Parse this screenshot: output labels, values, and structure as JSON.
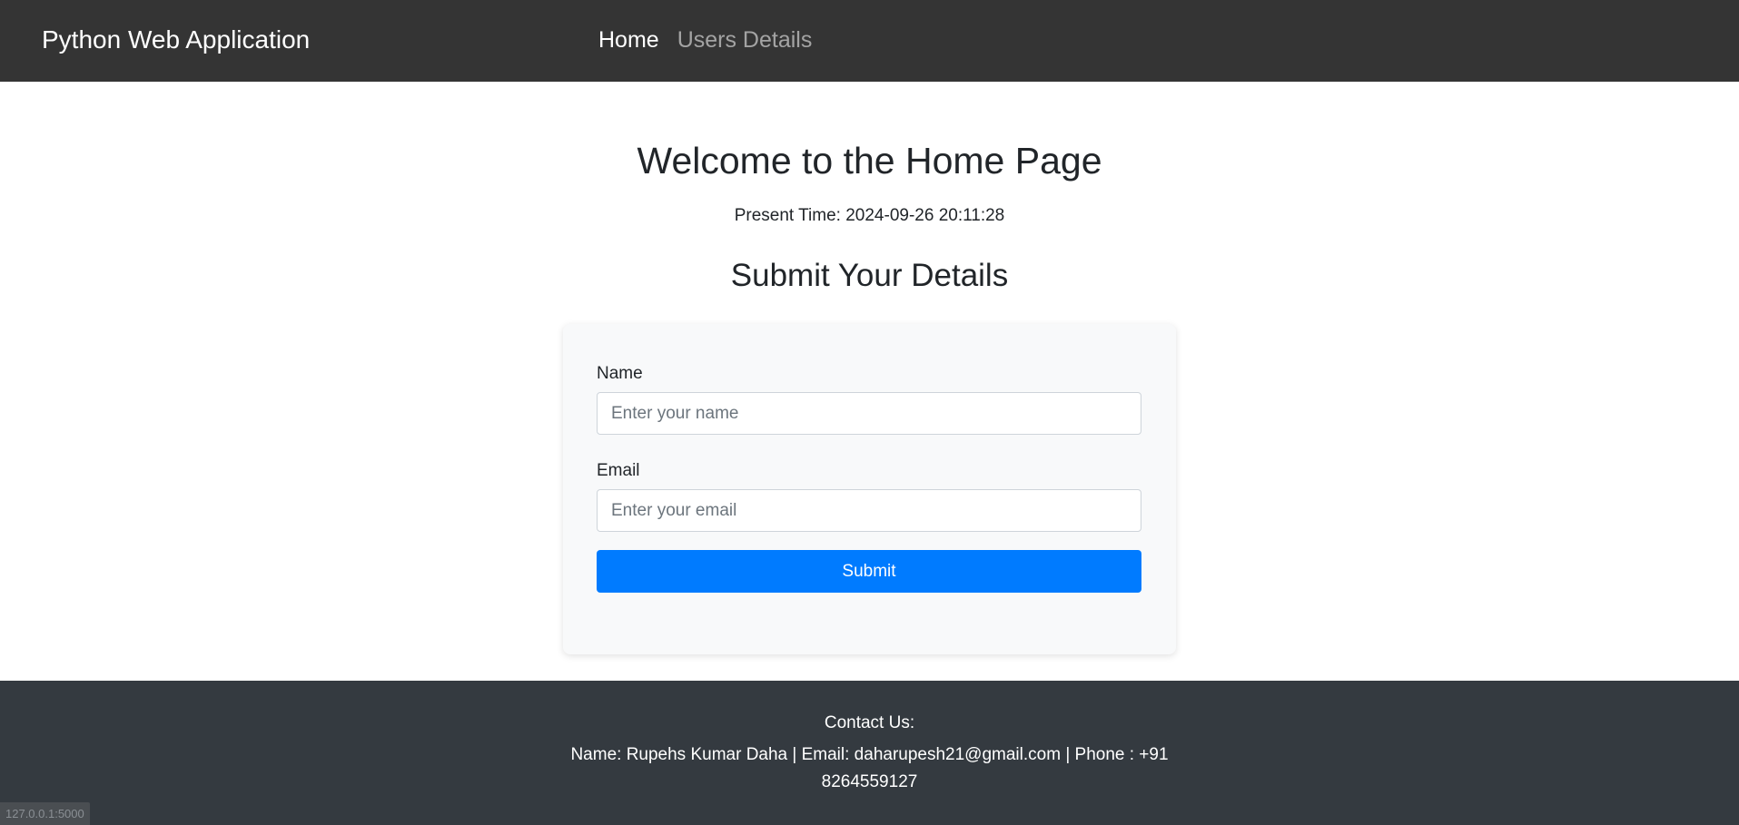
{
  "navbar": {
    "brand": "Python Web Application",
    "links": [
      {
        "label": "Home",
        "active": true
      },
      {
        "label": "Users Details",
        "active": false
      }
    ]
  },
  "main": {
    "title": "Welcome to the Home Page",
    "present_time": "Present Time: 2024-09-26 20:11:28",
    "form_title": "Submit Your Details",
    "form": {
      "name_label": "Name",
      "name_placeholder": "Enter your name",
      "name_value": "",
      "email_label": "Email",
      "email_placeholder": "Enter your email",
      "email_value": "",
      "submit_label": "Submit"
    }
  },
  "footer": {
    "heading": "Contact Us:",
    "contact": "Name: Rupehs Kumar Daha | Email: daharupesh21@gmail.com | Phone : +91 8264559127"
  },
  "status_bar": {
    "url": "127.0.0.1:5000"
  },
  "colors": {
    "navbar_bg": "#343434",
    "footer_bg": "#343a40",
    "primary": "#007bff",
    "card_bg": "#f8f9fa"
  }
}
